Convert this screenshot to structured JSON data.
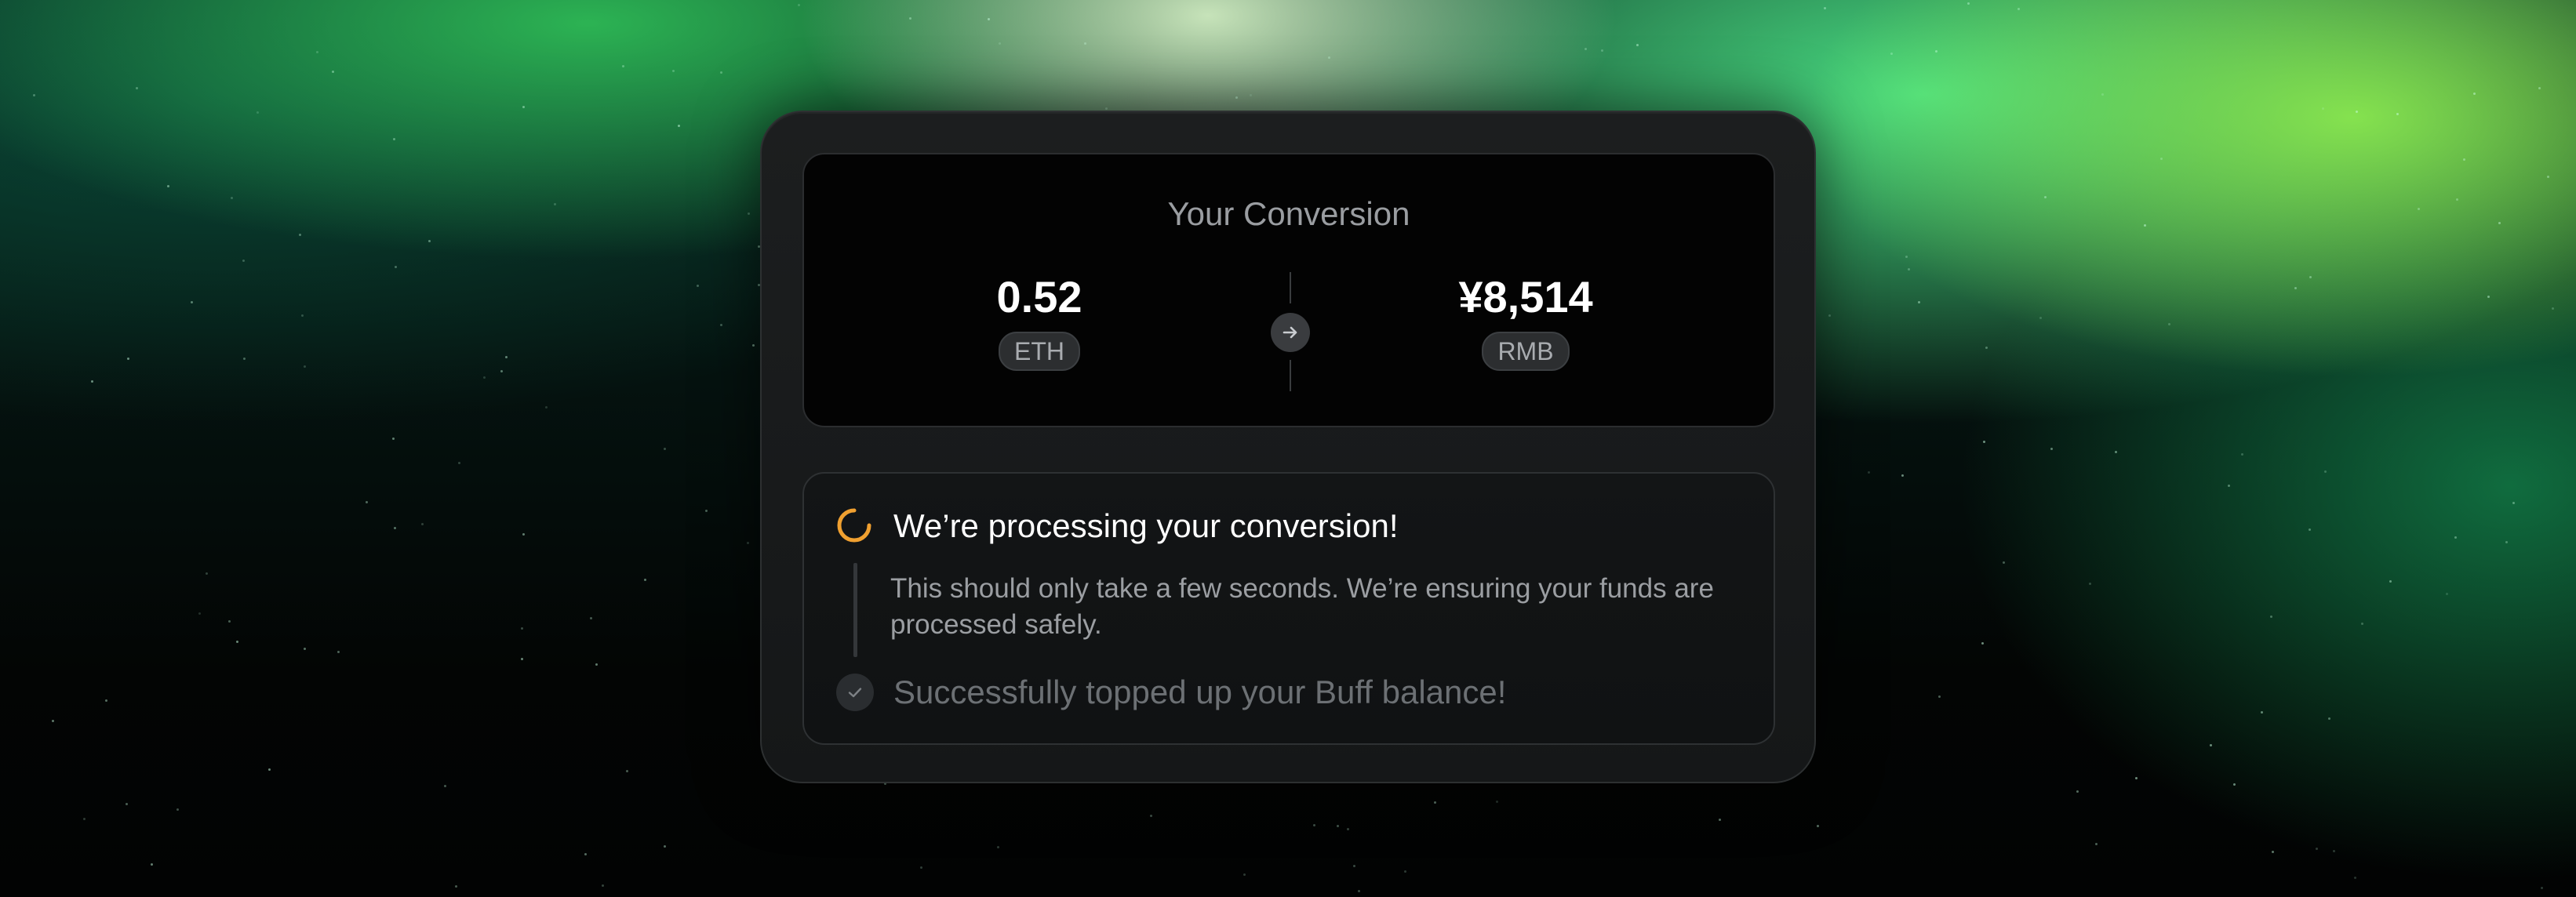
{
  "conversion": {
    "title": "Your Conversion",
    "from": {
      "amount": "0.52",
      "currency": "ETH"
    },
    "to": {
      "amount": "¥8,514",
      "currency": "RMB"
    },
    "arrow_icon": "arrow-right-icon"
  },
  "status": {
    "processing": {
      "icon": "spinner-icon",
      "title": "We’re processing your conversion!",
      "description": "This should only take a few seconds. We’re ensuring your funds are processed safely."
    },
    "completed": {
      "icon": "check-icon",
      "title": "Successfully topped up your Buff balance!"
    }
  },
  "colors": {
    "accent_spinner": "#f0a030",
    "card_background": "#1a1c1d",
    "background_glow": "#4ae58a"
  }
}
